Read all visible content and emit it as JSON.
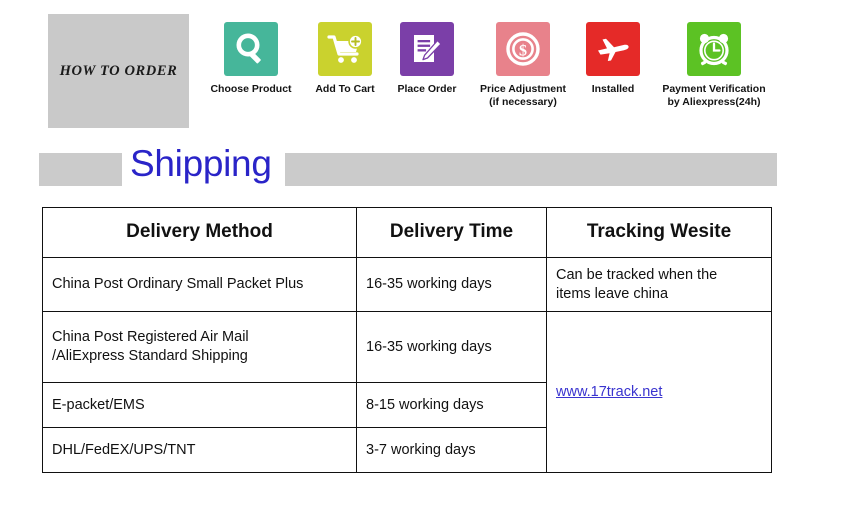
{
  "how_to_order": {
    "banner_label": "HOW  TO  ORDER",
    "steps": [
      {
        "label": "Choose Product",
        "icon": "magnifier-icon",
        "color": "#46b69a"
      },
      {
        "label": "Add To Cart",
        "icon": "shopping-cart-plus-icon",
        "color": "#cad22e"
      },
      {
        "label": "Place Order",
        "icon": "document-pen-icon",
        "color": "#7b3fa8"
      },
      {
        "label": "Price  Adjustment\n(if necessary)",
        "icon": "dollar-coin-icon",
        "color": "#e8828b"
      },
      {
        "label": "Installed",
        "icon": "airplane-icon",
        "color": "#e52a28"
      },
      {
        "label": "Payment Verification\nby Aliexpress(24h)",
        "icon": "alarm-clock-icon",
        "color": "#5cc224"
      }
    ]
  },
  "shipping": {
    "title": "Shipping",
    "table": {
      "headers": [
        "Delivery Method",
        "Delivery Time",
        "Tracking Wesite"
      ],
      "rows": [
        {
          "method": "China Post Ordinary Small Packet Plus",
          "time": "16-35 working days",
          "tracking": "Can be tracked when the\nitems leave china"
        },
        {
          "method": "China Post Registered Air Mail\n/AliExpress Standard Shipping",
          "time": "16-35 working days"
        },
        {
          "method": "E-packet/EMS",
          "time": "8-15 working days"
        },
        {
          "method": "DHL/FedEX/UPS/TNT",
          "time": "3-7 working days"
        }
      ],
      "tracking_link": "www.17track.net"
    }
  }
}
